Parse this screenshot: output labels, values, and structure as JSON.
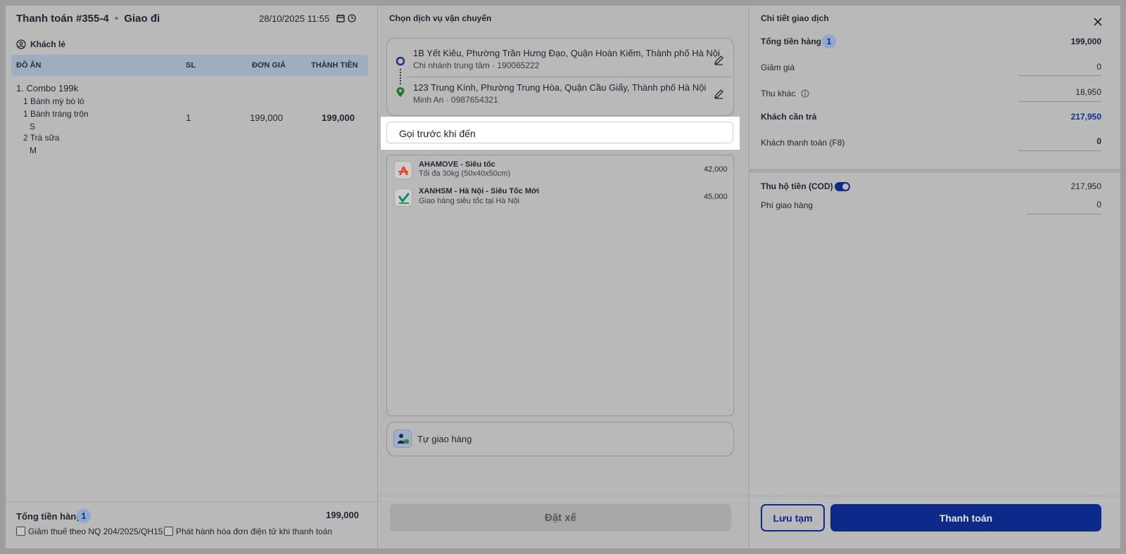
{
  "left": {
    "title": "Thanh toán #355-4",
    "title_sep": "•",
    "order_type": "Giao đi",
    "datetime": "28/10/2025 11:55",
    "customer": "Khách lẻ",
    "columns": {
      "item": "ĐỒ ĂN",
      "qty": "SL",
      "price": "ĐƠN GIÁ",
      "total": "THÀNH TIỀN"
    },
    "item": {
      "name": "1. Combo 199k",
      "sub1": "1 Bánh mỳ bò lò",
      "sub2": "1 Bánh tráng trộn",
      "sub2_size": "S",
      "sub3": "2 Trà sữa",
      "sub3_size": "M",
      "qty": "1",
      "price": "199,000",
      "total": "199,000"
    },
    "footer": {
      "total_label": "Tổng tiền hàng",
      "count": "1",
      "total_value": "199,000",
      "cb1": "Giảm thuế theo NQ 204/2025/QH15",
      "cb2": "Phát hành hóa đơn điện tử khi thanh toán"
    }
  },
  "middle": {
    "title": "Chọn dịch vụ vận chuyển",
    "pickup_address": "1B Yết Kiêu, Phường Trần Hưng Đạo, Quận Hoàn Kiếm, Thành phố Hà Nội",
    "pickup_contact": "Chi nhánh trung tâm · 190065222",
    "dropoff_address": "123 Trung Kính, Phường Trung Hòa, Quận Cầu Giấy, Thành phố Hà Nội",
    "dropoff_contact": "Minh An · 0987654321",
    "note_value": "Gọi trước khi đến",
    "services": [
      {
        "name": "AHAMOVE - Siêu tốc",
        "desc": "Tối đa 30kg (50x40x50cm)",
        "price": "42,000"
      },
      {
        "name": "XANHSM - Hà Nội - Siêu Tốc Mới",
        "desc": "Giao hàng siêu tốc tại Hà Nội",
        "price": "45,000"
      }
    ],
    "self_delivery": "Tự giao hàng",
    "book_button": "Đặt xế"
  },
  "right": {
    "title": "Chi tiết giao dịch",
    "subtotal_label": "Tổng tiền hàng",
    "subtotal_count": "1",
    "subtotal_value": "199,000",
    "discount_label": "Giảm giá",
    "discount_value": "0",
    "other_label": "Thu khác",
    "other_value": "18,950",
    "due_label": "Khách cần trả",
    "due_value": "217,950",
    "paid_label": "Khách thanh toán (F8)",
    "paid_value": "0",
    "cod_label": "Thu hộ tiền (COD)",
    "cod_value": "217,950",
    "ship_fee_label": "Phí giao hàng",
    "ship_fee_value": "0",
    "save_button": "Lưu tạm",
    "pay_button": "Thanh toán"
  },
  "colors": {
    "accent": "#0b2a8a",
    "accent_text": "#0f3296",
    "overlay": "#b9b9b9"
  },
  "icons": [
    "calendar-icon",
    "clock-icon",
    "user-circle-icon",
    "pickup-dot-icon",
    "location-pin-icon",
    "edit-icon",
    "info-icon",
    "close-icon",
    "toggle-icon",
    "delivery-person-icon"
  ]
}
